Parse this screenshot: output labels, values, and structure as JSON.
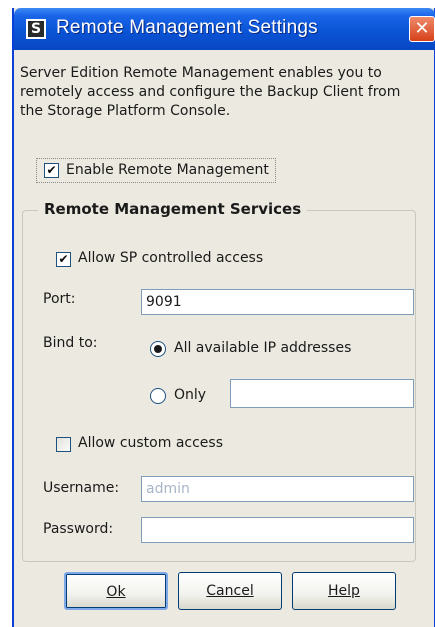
{
  "window": {
    "title": "Remote Management Settings",
    "icon_glyph": "S",
    "close_glyph": "✕",
    "accent": "#0a54d6",
    "close_color": "#d5411a",
    "background": "#eceae0"
  },
  "intro": "Server Edition Remote Management enables you to remotely access and configure the Backup Client from the Storage Platform Console.",
  "enable_remote": {
    "label": "Enable Remote Management",
    "checked": true
  },
  "services": {
    "title": "Remote Management Services",
    "allow_sp": {
      "label": "Allow SP controlled access",
      "checked": true
    },
    "port": {
      "label": "Port:",
      "value": "9091"
    },
    "bind": {
      "label": "Bind to:",
      "all": {
        "label": "All available IP addresses",
        "selected": true
      },
      "only": {
        "label": "Only",
        "selected": false,
        "value": ""
      }
    },
    "allow_custom": {
      "label": "Allow custom access",
      "checked": false
    },
    "username": {
      "label": "Username:",
      "value": "admin"
    },
    "password": {
      "label": "Password:",
      "value": ""
    }
  },
  "buttons": {
    "ok": {
      "label": "Ok"
    },
    "cancel": {
      "label": "Cancel"
    },
    "help": {
      "label": "Help"
    }
  },
  "icons": {
    "check": "✔",
    "app": "app-icon",
    "close": "close-icon"
  }
}
